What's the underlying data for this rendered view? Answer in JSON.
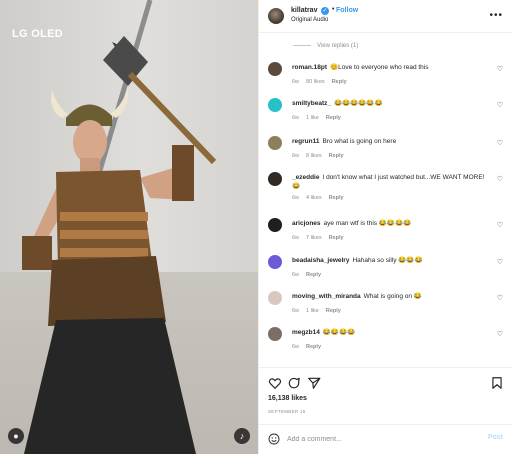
{
  "media": {
    "brand_overlay": "LG OLED"
  },
  "post": {
    "username": "killatrav",
    "follow_label": "Follow",
    "audio_label": "Original Audio",
    "view_replies_label": "View replies (1)"
  },
  "comments": [
    {
      "user": "roman.18pt",
      "text": "😊Love to everyone who read this",
      "time": "6w",
      "likes": "80 likes",
      "reply": "Reply",
      "avatar_color": "#5a4a3c"
    },
    {
      "user": "smiltybeatz_",
      "text": "😂😂😂😂😂😂",
      "time": "6w",
      "likes": "1 like",
      "reply": "Reply",
      "avatar_color": "#27c0c9"
    },
    {
      "user": "regrun11",
      "text": "Bro what is going on here",
      "time": "6w",
      "likes": "8 likes",
      "reply": "Reply",
      "avatar_color": "#8d7e5c"
    },
    {
      "user": "_ezeddie",
      "text": "I don't know what I just watched but...WE WANT MORE! 😂",
      "time": "6w",
      "likes": "4 likes",
      "reply": "Reply",
      "avatar_color": "#2f2a24"
    },
    {
      "user": "aricjones",
      "text": "aye man wtf is this 😂😂😂😂",
      "time": "6w",
      "likes": "7 likes",
      "reply": "Reply",
      "avatar_color": "#1f1f1f"
    },
    {
      "user": "beadaisha_jewelry",
      "text": "Hahaha so silly 😂😂😂",
      "time": "6w",
      "likes": "",
      "reply": "Reply",
      "avatar_color": "#6b5bd6"
    },
    {
      "user": "moving_with_miranda",
      "text": "What is going on 😂",
      "time": "6w",
      "likes": "1 like",
      "reply": "Reply",
      "avatar_color": "#d9c8bf"
    },
    {
      "user": "megzb14",
      "text": "😂😂😂😂",
      "time": "6w",
      "likes": "",
      "reply": "Reply",
      "avatar_color": "#7a6e66"
    }
  ],
  "stats": {
    "likes": "16,138 likes",
    "date": "SEPTEMBER 15"
  },
  "composer": {
    "placeholder": "Add a comment...",
    "post_label": "Post"
  },
  "colors": {
    "accent": "#3897f0",
    "muted": "#8e8e8e",
    "post_disabled": "#b2dffc"
  }
}
